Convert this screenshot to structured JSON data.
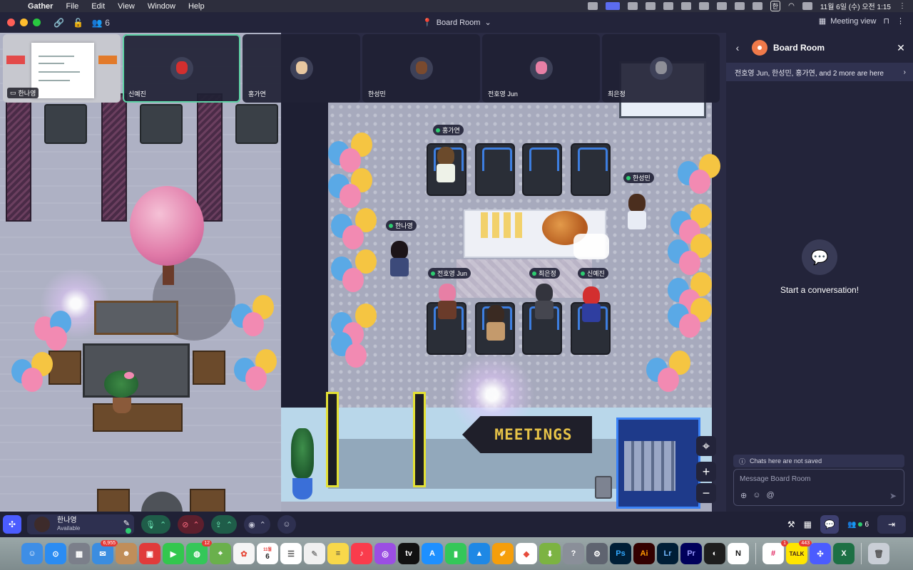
{
  "menubar": {
    "app_name": "Gather",
    "items": [
      "File",
      "Edit",
      "View",
      "Window",
      "Help"
    ],
    "clock": "11월 6일 (수) 오전 1:15",
    "input_lang": "한"
  },
  "titlebar": {
    "participant_count": "6",
    "room_name": "Board Room",
    "view_mode": "Meeting view"
  },
  "video_strip": {
    "tiles": [
      {
        "name": "한나영",
        "type": "screen"
      },
      {
        "name": "신예진",
        "type": "video",
        "active": true
      },
      {
        "name": "홍가연",
        "type": "video"
      },
      {
        "name": "한성민",
        "type": "video"
      },
      {
        "name": "전호영 Jun",
        "type": "video"
      },
      {
        "name": "최은정",
        "type": "video"
      }
    ]
  },
  "map": {
    "sign_text": "MEETINGS",
    "name_tags": [
      {
        "name": "홍가연"
      },
      {
        "name": "한성민"
      },
      {
        "name": "한나영"
      },
      {
        "name": "전호영 Jun"
      },
      {
        "name": "최은정"
      },
      {
        "name": "신예진"
      }
    ]
  },
  "panel": {
    "title": "Board Room",
    "here_text": "전호영 Jun, 한성민, 홍가연, and 2 more are here",
    "empty_text": "Start a conversation!",
    "not_saved": "Chats here are not saved",
    "placeholder": "Message Board Room"
  },
  "bottombar": {
    "user_name": "한나영",
    "user_status": "Available",
    "participant_count": "6"
  },
  "dock": {
    "mail_badge": "6,955",
    "messages_badge": "12",
    "calendar_day": "6",
    "calendar_month": "11월",
    "kakao_badge": "443",
    "slack_badge": "1"
  },
  "colors": {
    "accent": "#4b5cff",
    "active_outline": "#5ed3a6",
    "room_pin": "#f07a4a",
    "online": "#2ecc71"
  }
}
